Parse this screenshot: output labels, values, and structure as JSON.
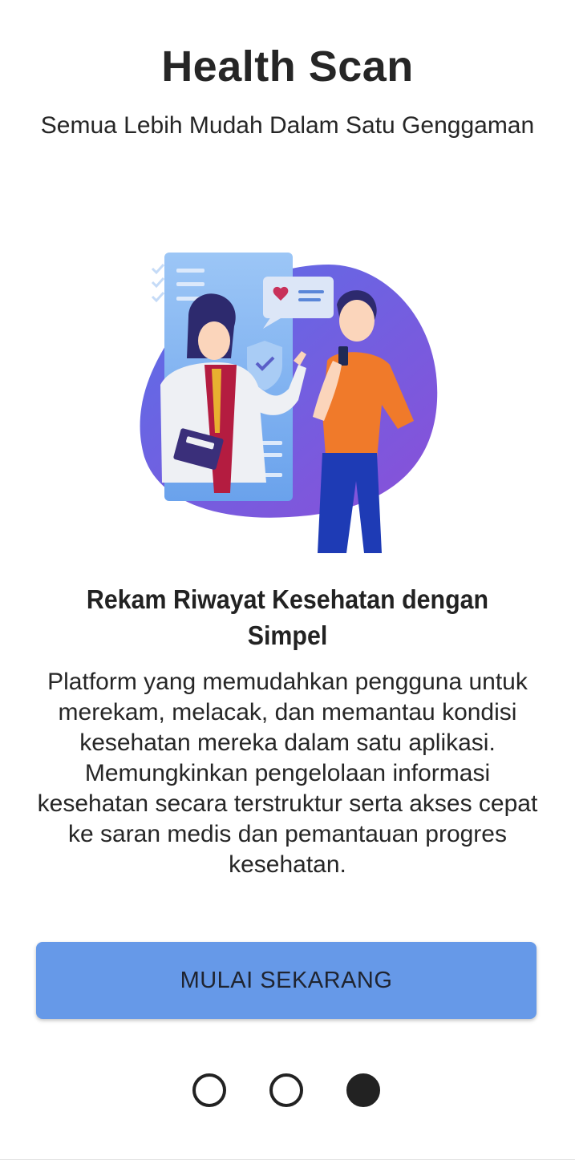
{
  "header": {
    "title": "Health Scan",
    "subtitle": "Semua Lebih Mudah Dalam Satu Genggaman"
  },
  "onboarding": {
    "illustration_icon": "doctor-patient-illustration",
    "feature_title": "Rekam Riwayat Kesehatan dengan Simpel",
    "feature_description": "Platform yang memudahkan pengguna untuk merekam, melacak, dan memantau kondisi kesehatan mereka dalam satu aplikasi. Memungkinkan pengelolaan informasi kesehatan secara terstruktur serta akses cepat ke saran medis dan pemantauan progres kesehatan."
  },
  "cta": {
    "label": "MULAI SEKARANG"
  },
  "pager": {
    "total": 3,
    "current": 3
  },
  "colors": {
    "button_bg": "#6699e8",
    "text": "#262626",
    "blob": "#7b5ee0",
    "panel": "#8ab8f2"
  }
}
